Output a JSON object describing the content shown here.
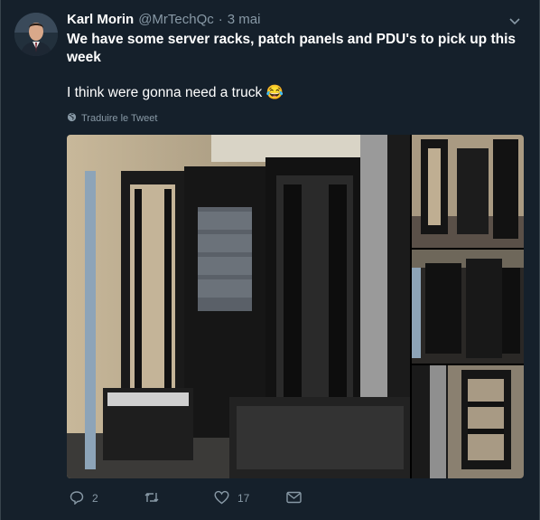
{
  "author": {
    "name": "Karl Morin",
    "handle": "@MrTechQc",
    "separator": "·",
    "date": "3 mai"
  },
  "tweet": {
    "line1": "We have some server racks, patch panels and PDU's to pick up this week",
    "line2": "I think were gonna need a truck",
    "emoji": "😂"
  },
  "translate_label": "Traduire le Tweet",
  "actions": {
    "reply_count": "2",
    "retweet_count": "",
    "like_count": "17"
  },
  "colors": {
    "background": "#15202b",
    "secondary_text": "#8899a6",
    "border": "#38444d"
  },
  "icons": [
    "chevron-down-icon",
    "globe-icon",
    "reply-icon",
    "retweet-icon",
    "like-icon",
    "message-icon"
  ]
}
